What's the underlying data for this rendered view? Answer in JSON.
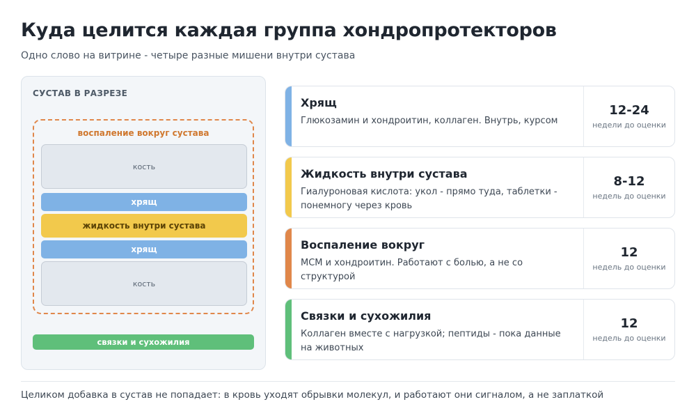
{
  "header": {
    "title": "Куда целится каждая группа хондропротекторов",
    "subtitle": "Одно слово на витрине - четыре разные мишени внутри сустава"
  },
  "joint": {
    "label": "СУСТАВ В РАЗРЕЗЕ",
    "inflammation_label": "воспаление вокруг сустава",
    "bone_top": "кость",
    "cartilage_top": "хрящ",
    "fluid": "жидкость внутри сустава",
    "cartilage_bottom": "хрящ",
    "bone_bottom": "кость",
    "ligaments": "связки и сухожилия"
  },
  "cards": [
    {
      "title": "Хрящ",
      "description": "Глюкозамин и хондроитин, коллаген. Внутрь, курсом",
      "value": "12-24",
      "unit": "недели до оценки",
      "color": "#7fb2e5"
    },
    {
      "title": "Жидкость внутри сустава",
      "description": "Гиалуроновая кислота: укол - прямо туда, таблетки - понемногу через кровь",
      "value": "8-12",
      "unit": "недель до оценки",
      "color": "#f2c94c"
    },
    {
      "title": "Воспаление вокруг",
      "description": "MCM и хондроитин. Работают с болью, а не со структурой",
      "value": "12",
      "unit": "недель до оценки",
      "color": "#e0874a"
    },
    {
      "title": "Связки и сухожилия",
      "description": "Коллаген вместе с нагрузкой; пептиды - пока данные на животных",
      "value": "12",
      "unit": "недель до оценки",
      "color": "#5fbf7a"
    }
  ],
  "footer": {
    "note": "Целиком добавка в сустав не попадает: в кровь уходят обрывки молекул, и работают они сигналом, а не заплаткой"
  }
}
